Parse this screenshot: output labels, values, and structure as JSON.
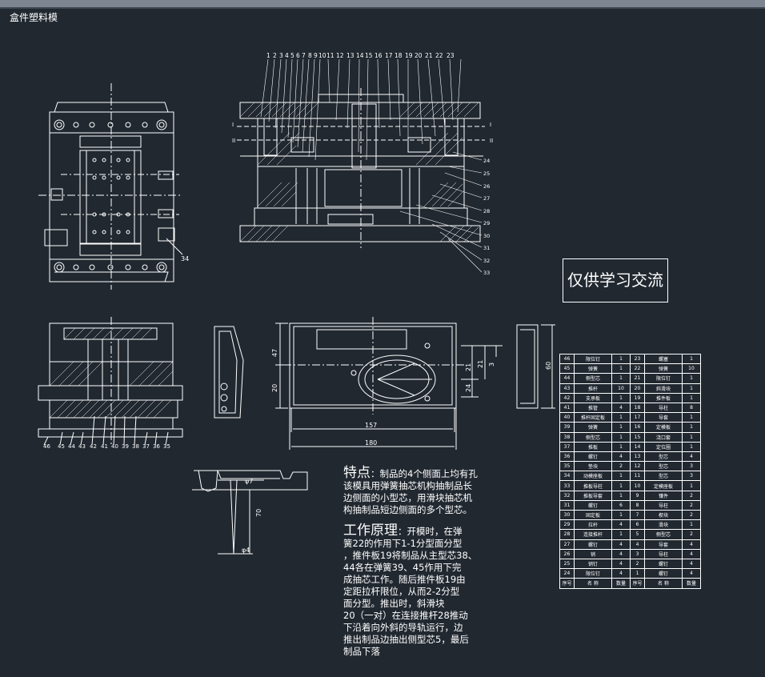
{
  "window": {
    "title": "盒件塑料模"
  },
  "stamp": "仅供学习交流",
  "top_balloons": [
    "1",
    "2",
    "3",
    "4",
    "5",
    "6",
    "7",
    "8",
    "9",
    "10",
    "11",
    "12",
    "13",
    "14",
    "15",
    "16",
    "17",
    "18",
    "19",
    "20",
    "21",
    "22",
    "23"
  ],
  "right_balloons": [
    "24",
    "25",
    "26",
    "27",
    "28",
    "29",
    "30",
    "31",
    "32",
    "33"
  ],
  "bottom_balloons": [
    "46",
    "45",
    "44",
    "43",
    "42",
    "41",
    "40",
    "39",
    "38",
    "37",
    "36",
    "35"
  ],
  "plan_balloon": "34",
  "section_marks": {
    "s1": "I",
    "s2": "II"
  },
  "dims": {
    "d157": "157",
    "d180": "180",
    "d47": "47",
    "d20": "20",
    "d21a": "21",
    "d21b": "21",
    "d3": "3",
    "d24": "24",
    "d60": "60",
    "phi7": "φ7",
    "d70": "70",
    "phi4": "φ4"
  },
  "notes": {
    "feature_title": "特点",
    "feature_lines": [
      "：制品的4个侧面上均有孔",
      "该模具用弹簧抽芯机构抽制品长",
      "边侧面的小型芯，用滑块抽芯机",
      "构抽制品短边侧面的多个型芯。"
    ],
    "principle_title": "工作原理",
    "principle_lines": [
      "：开模时，在弹",
      "簧22的作用下1-1分型面分型",
      "，推件板19将制品从主型芯38、",
      "44各在弹簧39、45作用下完",
      "成抽芯工作。随后推件板19由",
      "定距拉杆限位，从而2-2分型",
      "面分型。推出时，斜滑块",
      "20（一对）在连接推杆28推动",
      "下沿着向外斜的导轨运行，边",
      "推出制品边抽出侧型芯5，最后",
      "制品下落"
    ]
  },
  "bom": {
    "rows": [
      [
        "46",
        "限位钉",
        "1",
        "23",
        "螺塞",
        "1"
      ],
      [
        "45",
        "弹簧",
        "1",
        "22",
        "弹簧",
        "10"
      ],
      [
        "44",
        "侧型芯",
        "1",
        "21",
        "限位钉",
        "1"
      ],
      [
        "43",
        "推杆",
        "10",
        "20",
        "斜滑块",
        "1"
      ],
      [
        "42",
        "支承板",
        "1",
        "19",
        "推件板",
        "1"
      ],
      [
        "41",
        "推管",
        "4",
        "18",
        "导柱",
        "8"
      ],
      [
        "40",
        "推杆固定板",
        "1",
        "17",
        "导套",
        "1"
      ],
      [
        "39",
        "弹簧",
        "1",
        "16",
        "定模板",
        "1"
      ],
      [
        "38",
        "侧型芯",
        "1",
        "15",
        "浇口套",
        "1"
      ],
      [
        "37",
        "推板",
        "1",
        "14",
        "定位圈",
        "1"
      ],
      [
        "36",
        "螺钉",
        "4",
        "13",
        "型芯",
        "4"
      ],
      [
        "35",
        "垫块",
        "2",
        "12",
        "型芯",
        "3"
      ],
      [
        "34",
        "动模座板",
        "1",
        "11",
        "型芯",
        "3"
      ],
      [
        "33",
        "推板导柱",
        "1",
        "10",
        "定模座板",
        "1"
      ],
      [
        "32",
        "推板导套",
        "1",
        "9",
        "镶件",
        "2"
      ],
      [
        "31",
        "螺钉",
        "6",
        "8",
        "导柱",
        "2"
      ],
      [
        "30",
        "固定板",
        "1",
        "7",
        "楔块",
        "2"
      ],
      [
        "29",
        "拉杆",
        "4",
        "6",
        "滑块",
        "1"
      ],
      [
        "28",
        "连接推杆",
        "1",
        "5",
        "侧型芯",
        "2"
      ],
      [
        "27",
        "螺钉",
        "4",
        "4",
        "导套",
        "4"
      ],
      [
        "26",
        "销",
        "4",
        "3",
        "导柱",
        "4"
      ],
      [
        "25",
        "销钉",
        "4",
        "2",
        "螺钉",
        "4"
      ],
      [
        "24",
        "限位钉",
        "4",
        "1",
        "螺钉",
        "4"
      ]
    ],
    "header": [
      "序号",
      "名 称",
      "数量",
      "序号",
      "名 称",
      "数量"
    ]
  }
}
